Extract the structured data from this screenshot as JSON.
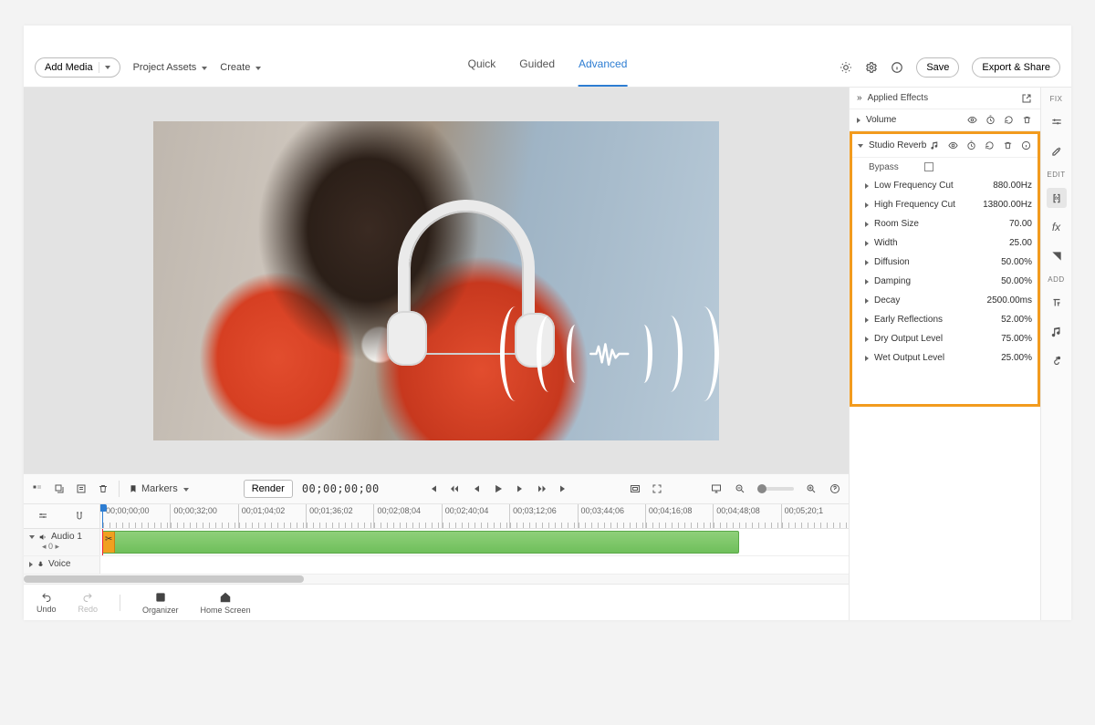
{
  "topbar": {
    "add_media": "Add Media",
    "project_assets": "Project Assets",
    "create": "Create",
    "tabs": {
      "quick": "Quick",
      "guided": "Guided",
      "advanced": "Advanced"
    },
    "save": "Save",
    "export": "Export & Share"
  },
  "timeline": {
    "markers": "Markers",
    "render": "Render",
    "timecode": "00;00;00;00",
    "ruler": [
      "00;00;00;00",
      "00;00;32;00",
      "00;01;04;02",
      "00;01;36;02",
      "00;02;08;04",
      "00;02;40;04",
      "00;03;12;06",
      "00;03;44;06",
      "00;04;16;08",
      "00;04;48;08",
      "00;05;20;1"
    ],
    "tracks": {
      "audio1": {
        "name": "Audio 1",
        "balance": "◂ 0 ▸"
      },
      "voice": {
        "name": "Voice"
      }
    }
  },
  "bottombar": {
    "undo": "Undo",
    "redo": "Redo",
    "organizer": "Organizer",
    "home": "Home Screen"
  },
  "effects": {
    "applied": "Applied Effects",
    "volume": "Volume",
    "studio_reverb": "Studio Reverb",
    "bypass": "Bypass",
    "params": [
      {
        "label": "Low Frequency Cut",
        "value": "880.00Hz"
      },
      {
        "label": "High Frequency Cut",
        "value": "13800.00Hz"
      },
      {
        "label": "Room Size",
        "value": "70.00"
      },
      {
        "label": "Width",
        "value": "25.00"
      },
      {
        "label": "Diffusion",
        "value": "50.00%"
      },
      {
        "label": "Damping",
        "value": "50.00%"
      },
      {
        "label": "Decay",
        "value": "2500.00ms"
      },
      {
        "label": "Early Reflections",
        "value": "52.00%"
      },
      {
        "label": "Dry Output Level",
        "value": "75.00%"
      },
      {
        "label": "Wet Output Level",
        "value": "25.00%"
      }
    ]
  },
  "toolstrip": {
    "fix": "FIX",
    "edit": "EDIT",
    "add": "ADD"
  }
}
